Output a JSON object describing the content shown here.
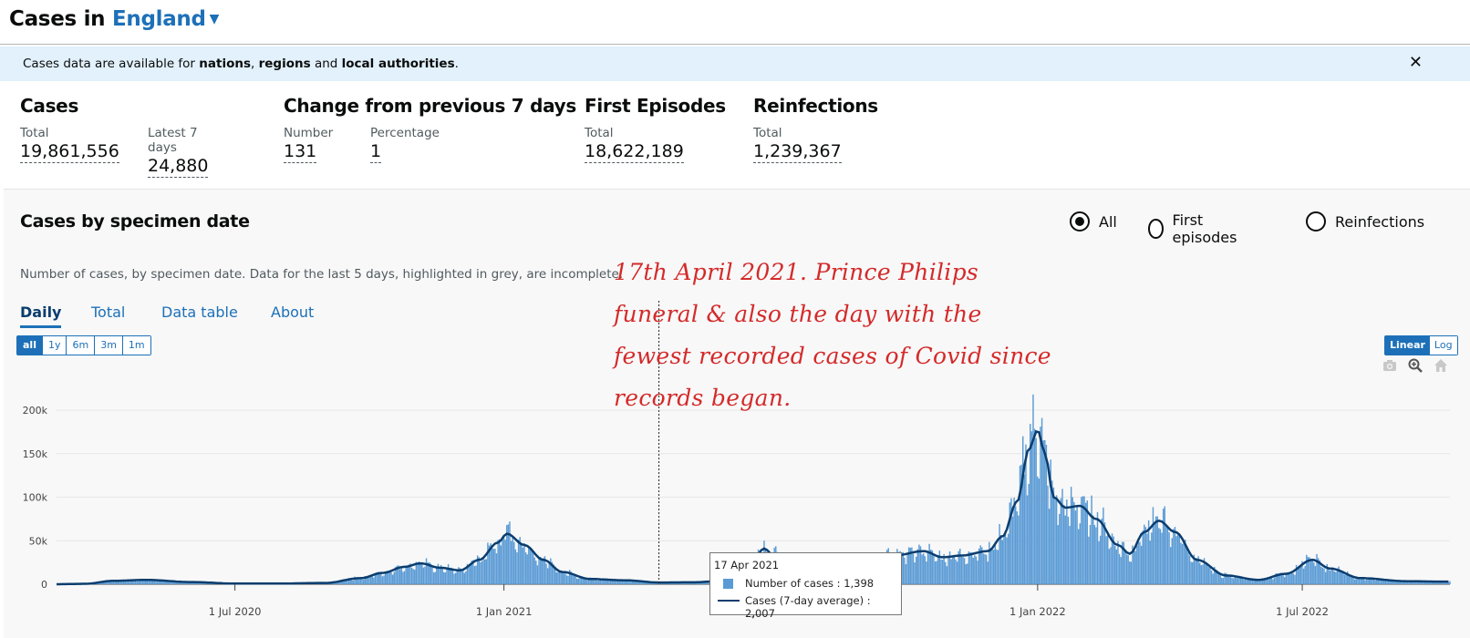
{
  "header": {
    "title_prefix": "Cases in",
    "area": "England"
  },
  "banner": {
    "text_1": "Cases data are available for",
    "nations": "nations",
    "sep_1": ",",
    "regions": "regions",
    "and": "and",
    "local": "local authorities",
    "end": "."
  },
  "headlines": {
    "cases": {
      "title": "Cases",
      "total_label": "Total",
      "total": "19,861,556",
      "latest_label": "Latest 7 days",
      "latest": "24,880"
    },
    "change": {
      "title": "Change from previous 7 days",
      "number_label": "Number",
      "number": "131",
      "percentage_label": "Percentage",
      "percentage": "1"
    },
    "first": {
      "title": "First Episodes",
      "total_label": "Total",
      "total": "18,622,189"
    },
    "reinf": {
      "title": "Reinfections",
      "total_label": "Total",
      "total": "1,239,367"
    }
  },
  "card": {
    "title": "Cases by specimen date",
    "subtitle": "Number of cases, by specimen date. Data for the last 5 days, highlighted in grey, are incomplete.",
    "radios": [
      {
        "label": "All",
        "selected": true
      },
      {
        "label": "First episodes",
        "selected": false
      },
      {
        "label": "Reinfections",
        "selected": false
      }
    ],
    "tabs": [
      "Daily",
      "Total",
      "Data table",
      "About"
    ],
    "range_buttons": [
      "all",
      "1y",
      "6m",
      "3m",
      "1m"
    ],
    "scale_buttons": [
      "Linear",
      "Log"
    ]
  },
  "annotation": {
    "line1": "17th April 2021.  Prince Philips",
    "line2": "funeral & also the day with the",
    "line3": "fewest recorded cases of Covid since",
    "line4": "records began."
  },
  "tooltip": {
    "date": "17 Apr 2021",
    "row1": "Number of cases : 1,398",
    "row2": "Cases (7-day average) : 2,007"
  },
  "colors": {
    "bar": "#5b9bd5",
    "line": "#0b3d6e",
    "link": "#1d70b8",
    "annotation": "#d42a2a"
  },
  "icons": [
    "camera-icon",
    "zoom-icon",
    "home-icon"
  ],
  "chart_data": {
    "type": "bar",
    "x_start": "2020-03-01",
    "x_end": "2022-10-10",
    "ylim": [
      0,
      200000
    ],
    "y_ticks": [
      "0",
      "50k",
      "100k",
      "150k",
      "200k"
    ],
    "x_ticks": [
      "1 Jul 2020",
      "1 Jan 2021",
      "1 Jul 2021",
      "1 Jan 2022",
      "1 Jul 2022"
    ],
    "hover_date": "2021-04-17",
    "series": [
      {
        "name": "Number of cases",
        "type": "bar"
      },
      {
        "name": "Cases (7-day average)",
        "type": "line"
      }
    ],
    "avg_profile": [
      [
        "2020-03-01",
        0
      ],
      [
        "2020-03-20",
        500
      ],
      [
        "2020-04-10",
        4000
      ],
      [
        "2020-05-01",
        5000
      ],
      [
        "2020-06-01",
        2500
      ],
      [
        "2020-07-01",
        800
      ],
      [
        "2020-08-01",
        800
      ],
      [
        "2020-09-01",
        1500
      ],
      [
        "2020-09-25",
        7000
      ],
      [
        "2020-10-10",
        13000
      ],
      [
        "2020-10-25",
        20000
      ],
      [
        "2020-11-05",
        24000
      ],
      [
        "2020-11-18",
        19000
      ],
      [
        "2020-12-02",
        16000
      ],
      [
        "2020-12-15",
        28000
      ],
      [
        "2020-12-28",
        48000
      ],
      [
        "2021-01-03",
        58000
      ],
      [
        "2021-01-15",
        45000
      ],
      [
        "2021-01-28",
        28000
      ],
      [
        "2021-02-10",
        14000
      ],
      [
        "2021-03-01",
        6000
      ],
      [
        "2021-03-25",
        4500
      ],
      [
        "2021-04-17",
        2007
      ],
      [
        "2021-05-10",
        2200
      ],
      [
        "2021-05-28",
        3500
      ],
      [
        "2021-06-08",
        12000
      ],
      [
        "2021-06-20",
        28000
      ],
      [
        "2021-06-28",
        41000
      ],
      [
        "2021-07-04",
        34000
      ],
      [
        "2021-07-15",
        25000
      ],
      [
        "2021-07-28",
        30000
      ],
      [
        "2021-08-05",
        24000
      ],
      [
        "2021-08-25",
        29000
      ],
      [
        "2021-09-10",
        30000
      ],
      [
        "2021-09-25",
        33000
      ],
      [
        "2021-10-15",
        38000
      ],
      [
        "2021-10-28",
        31000
      ],
      [
        "2021-11-10",
        33000
      ],
      [
        "2021-11-28",
        38000
      ],
      [
        "2021-12-08",
        55000
      ],
      [
        "2021-12-18",
        95000
      ],
      [
        "2021-12-26",
        155000
      ],
      [
        "2022-01-01",
        177000
      ],
      [
        "2022-01-06",
        150000
      ],
      [
        "2022-01-12",
        100000
      ],
      [
        "2022-01-20",
        88000
      ],
      [
        "2022-01-30",
        90000
      ],
      [
        "2022-02-10",
        75000
      ],
      [
        "2022-02-25",
        45000
      ],
      [
        "2022-03-05",
        35000
      ],
      [
        "2022-03-15",
        60000
      ],
      [
        "2022-03-25",
        73000
      ],
      [
        "2022-04-05",
        60000
      ],
      [
        "2022-04-20",
        28000
      ],
      [
        "2022-05-10",
        10000
      ],
      [
        "2022-06-01",
        5000
      ],
      [
        "2022-06-20",
        12000
      ],
      [
        "2022-07-08",
        28000
      ],
      [
        "2022-07-20",
        18000
      ],
      [
        "2022-08-10",
        7000
      ],
      [
        "2022-09-10",
        3500
      ],
      [
        "2022-10-05",
        3000
      ]
    ]
  }
}
